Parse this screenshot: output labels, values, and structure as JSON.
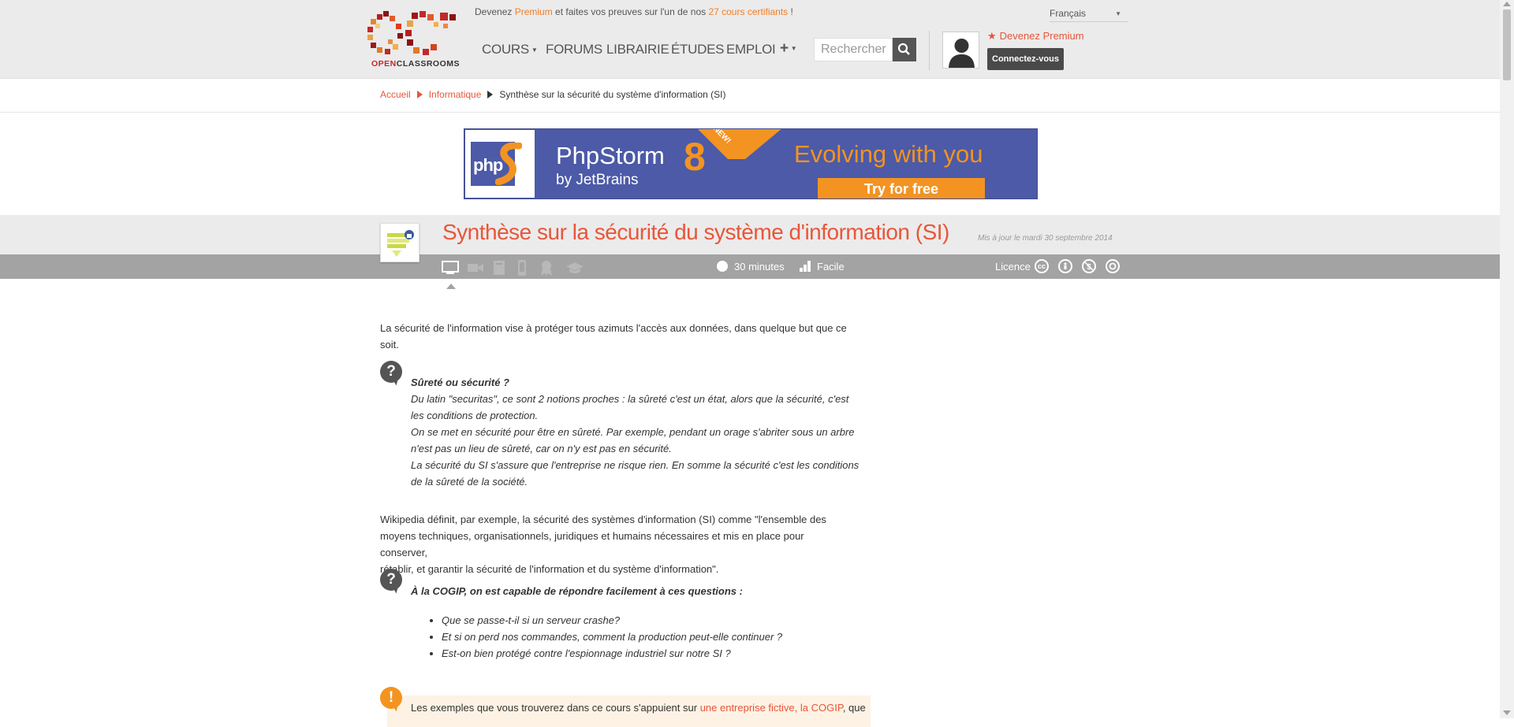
{
  "header": {
    "logo_text_a": "OPEN",
    "logo_text_b": "CLASSROOMS",
    "promo": {
      "before": "Devenez ",
      "premium": "Premium",
      "middle": " et faites vos preuves sur l'un de nos ",
      "count": "27 cours certifiants",
      "after": " !"
    },
    "language": "Français",
    "nav": {
      "cours": "COURS",
      "forums": "FORUMS",
      "librairie": "LIBRAIRIE",
      "etudes": "ÉTUDES",
      "emploi": "EMPLOI",
      "plus": "+"
    },
    "search_placeholder": "Rechercher",
    "premium_link": "Devenez Premium",
    "connect_button": "Connectez-vous"
  },
  "breadcrumb": {
    "home": "Accueil",
    "category": "Informatique",
    "current": "Synthèse sur la sécurité du système d'information (SI)"
  },
  "banner": {
    "logo": "php",
    "product": "PhpStorm",
    "version": "8",
    "by": "by JetBrains",
    "badge": "NEW!",
    "slogan": "Evolving with you",
    "cta": "Try for free"
  },
  "course": {
    "title": "Synthèse sur la sécurité du système d'information (SI)",
    "updated": "Mis à jour le mardi 30 septembre 2014",
    "duration": "30 minutes",
    "difficulty": "Facile",
    "licence": "Licence",
    "licence_icons": [
      "cc",
      "by",
      "nc",
      "sa"
    ],
    "format_icons": [
      "monitor-icon",
      "video-icon",
      "ebook-icon",
      "mobile-icon",
      "certificate-icon",
      "graduation-icon"
    ]
  },
  "content": {
    "intro_1": "La sécurité de l'information vise à protéger tous azimuts l'accès aux données, dans quelque but que ce",
    "intro_2": "soit.",
    "q1": {
      "title": "Sûreté ou sécurité ?",
      "lines": [
        "Du latin \"securitas\", ce sont 2 notions proches : la sûreté c'est un état, alors que la sécurité, c'est",
        "les conditions de protection.",
        "On se met en sécurité pour être en sûreté. Par exemple, pendant un orage s'abriter sous un arbre",
        "n'est pas un lieu de sûreté, car on n'y est pas en sécurité.",
        "La sécurité du SI s'assure que l'entreprise ne risque rien. En somme la sécurité c'est les conditions",
        "de la sûreté de la société."
      ]
    },
    "wiki": [
      "Wikipedia définit, par exemple, la sécurité des systèmes d'information (SI) comme \"l'ensemble des",
      "moyens techniques, organisationnels, juridiques et humains nécessaires et mis en place pour conserver,",
      "rétablir, et garantir la sécurité de l'information et du système d'information\"."
    ],
    "q2": {
      "title": "À la COGIP, on est capable de répondre facilement à ces questions :",
      "items": [
        "Que se passe-t-il si un serveur crashe?",
        "Et si on perd nos commandes, comment la production peut-elle continuer ?",
        "Est-on bien protégé contre l'espionnage industriel sur notre SI ?"
      ]
    },
    "note": {
      "before": "Les exemples que vous trouverez dans ce cours s'appuient sur ",
      "link": "une entreprise fictive, la COGIP",
      "after": ", que"
    }
  },
  "colors": {
    "accent": "#e8563a",
    "premium": "#f07e26",
    "course_bar": "#a3a3a3",
    "banner_bg": "#4c5aa7",
    "banner_orange": "#f39322"
  }
}
